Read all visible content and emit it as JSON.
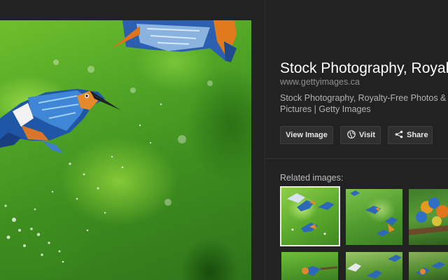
{
  "detail": {
    "title": "Stock Photography, Royalty-Free Photos & Pictures",
    "url": "www.gettyimages.ca",
    "description": "Stock Photography, Royalty-Free Photos & Pictures | Getty Images"
  },
  "actions": {
    "view_image": "View Image",
    "visit": "Visit",
    "share": "Share"
  },
  "related": {
    "label": "Related images:"
  },
  "colors": {
    "background": "#222222",
    "title": "#ffffff",
    "url": "#8f8f8f",
    "description": "#b3b3b3",
    "button_bg": "#303030"
  },
  "icons": {
    "visit": "globe-icon",
    "share": "share-icon"
  }
}
